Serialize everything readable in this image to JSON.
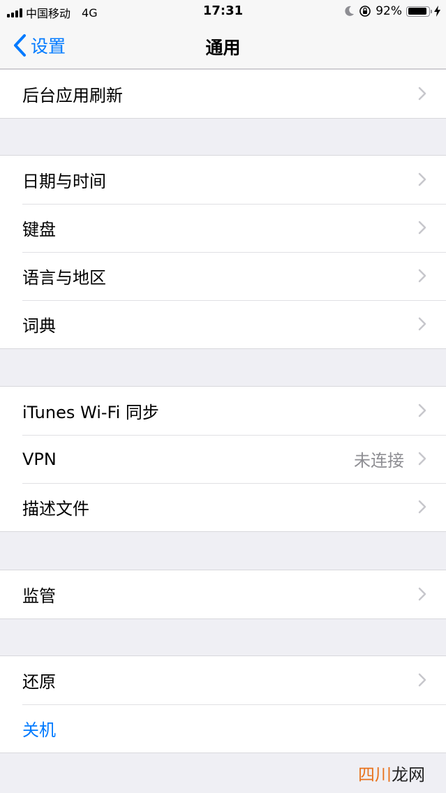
{
  "status_bar": {
    "carrier": "中国移动",
    "network": "4G",
    "time": "17:31",
    "battery_percent": "92%",
    "battery_level": 0.92,
    "icons": [
      "signal-icon",
      "moon-icon",
      "rotation-lock-icon",
      "battery-icon",
      "charging-bolt-icon"
    ]
  },
  "nav": {
    "back_label": "设置",
    "title": "通用"
  },
  "groups": [
    {
      "rows": [
        {
          "label": "后台应用刷新"
        }
      ]
    },
    {
      "rows": [
        {
          "label": "日期与时间"
        },
        {
          "label": "键盘"
        },
        {
          "label": "语言与地区"
        },
        {
          "label": "词典"
        }
      ]
    },
    {
      "rows": [
        {
          "label": "iTunes Wi-Fi 同步"
        },
        {
          "label": "VPN",
          "value": "未连接"
        },
        {
          "label": "描述文件"
        }
      ]
    },
    {
      "rows": [
        {
          "label": "监管"
        }
      ]
    },
    {
      "rows": [
        {
          "label": "还原"
        },
        {
          "label": "关机"
        }
      ]
    }
  ],
  "watermark": {
    "part1": "四川",
    "part2": "龙网"
  },
  "colors": {
    "accent": "#007aff",
    "background": "#efeff4",
    "chevron": "#c7c7cc"
  }
}
